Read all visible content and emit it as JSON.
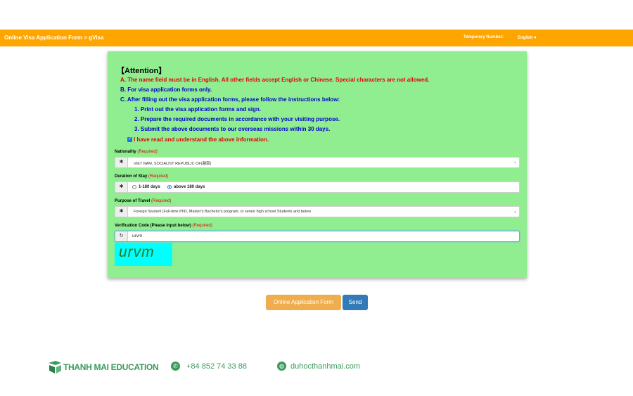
{
  "header": {
    "breadcrumb": "Online Visa Application Form > gVisa",
    "temporary_number_label": "Temporary Number:",
    "language": "English ▾"
  },
  "attention": {
    "title": "【Attention】",
    "a": "A. The name field must be in English. All other fields accept English or Chinese. Special characters are not allowed.",
    "b": "B. For visa application forms only.",
    "c": "C. After filling out the visa application forms, please follow the instructions below:",
    "c1": "1. Print out the visa application forms and sign.",
    "c2": "2. Prepare the required documents in accordance with your visiting purpose.",
    "c3": "3. Submit the above documents to our overseas missions within 30 days.",
    "agree": "I have read and understand the above information.",
    "agree_checked": true
  },
  "form": {
    "required": "(Required)",
    "nationality_label": "Nationality",
    "nationality_value": "VIET NAM, SOCIALIST REPUBLIC OF(越南)",
    "duration_label": "Duration of Stay",
    "duration_opt1": "1-180 days",
    "duration_opt2": "above 180 days",
    "duration_selected": "above 180 days",
    "purpose_label": "Purpose of Travel",
    "purpose_value": "Foreign Student (Full-time PhD, Master's Bachelor's program, or senior high school Students and below",
    "verify_label": "Verification Code (Please input below)",
    "verify_value": "urvm",
    "captcha_text": "urvm"
  },
  "buttons": {
    "online_form": "Online Application Form",
    "send": "Send"
  },
  "footer": {
    "brand": "THANH MAI EDUCATION",
    "phone": "+84 852 74 33 88",
    "website": "duhocthanhmai.com"
  },
  "colors": {
    "topbar": "#ffa500",
    "panel": "#90ee90",
    "required": "#e60000",
    "brand_green": "#3b9b5c",
    "send_button": "#337ab7",
    "form_button": "#f0ad4e",
    "captcha_bg": "#00ffff"
  }
}
